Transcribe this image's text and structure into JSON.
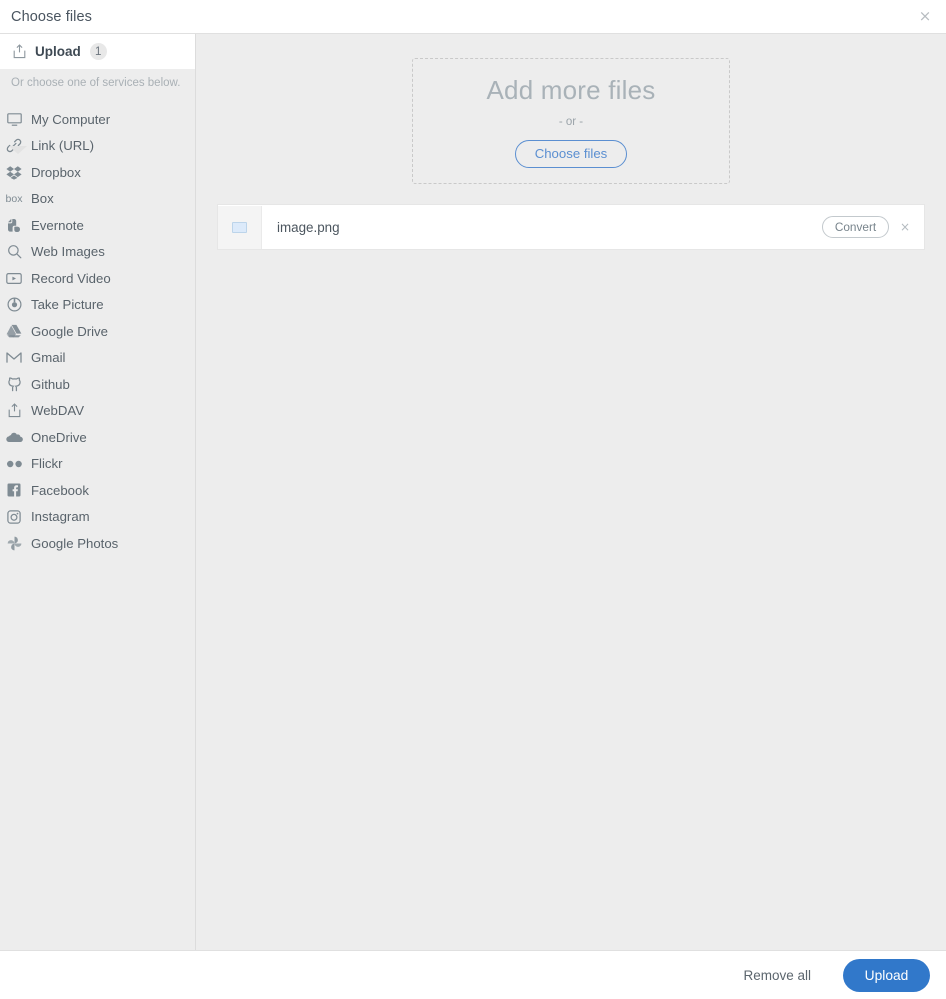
{
  "header": {
    "title": "Choose files",
    "close_label": "×"
  },
  "sidebar": {
    "upload_tab": {
      "label": "Upload",
      "badge": "1",
      "icon": "upload-icon"
    },
    "services_note": "Or choose one of services below.",
    "items": [
      {
        "label": "My Computer",
        "icon": "monitor-icon"
      },
      {
        "label": "Link (URL)",
        "icon": "link-icon"
      },
      {
        "label": "Dropbox",
        "icon": "dropbox-icon"
      },
      {
        "label": "Box",
        "icon": "box-icon"
      },
      {
        "label": "Evernote",
        "icon": "evernote-icon"
      },
      {
        "label": "Web Images",
        "icon": "search-icon"
      },
      {
        "label": "Record Video",
        "icon": "video-icon"
      },
      {
        "label": "Take Picture",
        "icon": "camera-icon"
      },
      {
        "label": "Google Drive",
        "icon": "google-drive-icon"
      },
      {
        "label": "Gmail",
        "icon": "gmail-icon"
      },
      {
        "label": "Github",
        "icon": "github-icon"
      },
      {
        "label": "WebDAV",
        "icon": "webdav-icon"
      },
      {
        "label": "OneDrive",
        "icon": "onedrive-icon"
      },
      {
        "label": "Flickr",
        "icon": "flickr-icon"
      },
      {
        "label": "Facebook",
        "icon": "facebook-icon"
      },
      {
        "label": "Instagram",
        "icon": "instagram-icon"
      },
      {
        "label": "Google Photos",
        "icon": "google-photos-icon"
      }
    ]
  },
  "main": {
    "dropzone": {
      "title": "Add more files",
      "or_text": "- or -",
      "choose_button": "Choose files"
    },
    "files": [
      {
        "name": "image.png",
        "convert_label": "Convert",
        "remove_label": "×",
        "thumbnail": "image-placeholder-icon"
      }
    ]
  },
  "footer": {
    "remove_all_label": "Remove all",
    "upload_label": "Upload"
  },
  "colors": {
    "accent_blue": "#3178ca",
    "link_blue": "#5b8fd1",
    "panel_gray": "#ededed",
    "white": "#ffffff",
    "text_gray": "#59636b",
    "muted_gray": "#a9b2b8"
  }
}
